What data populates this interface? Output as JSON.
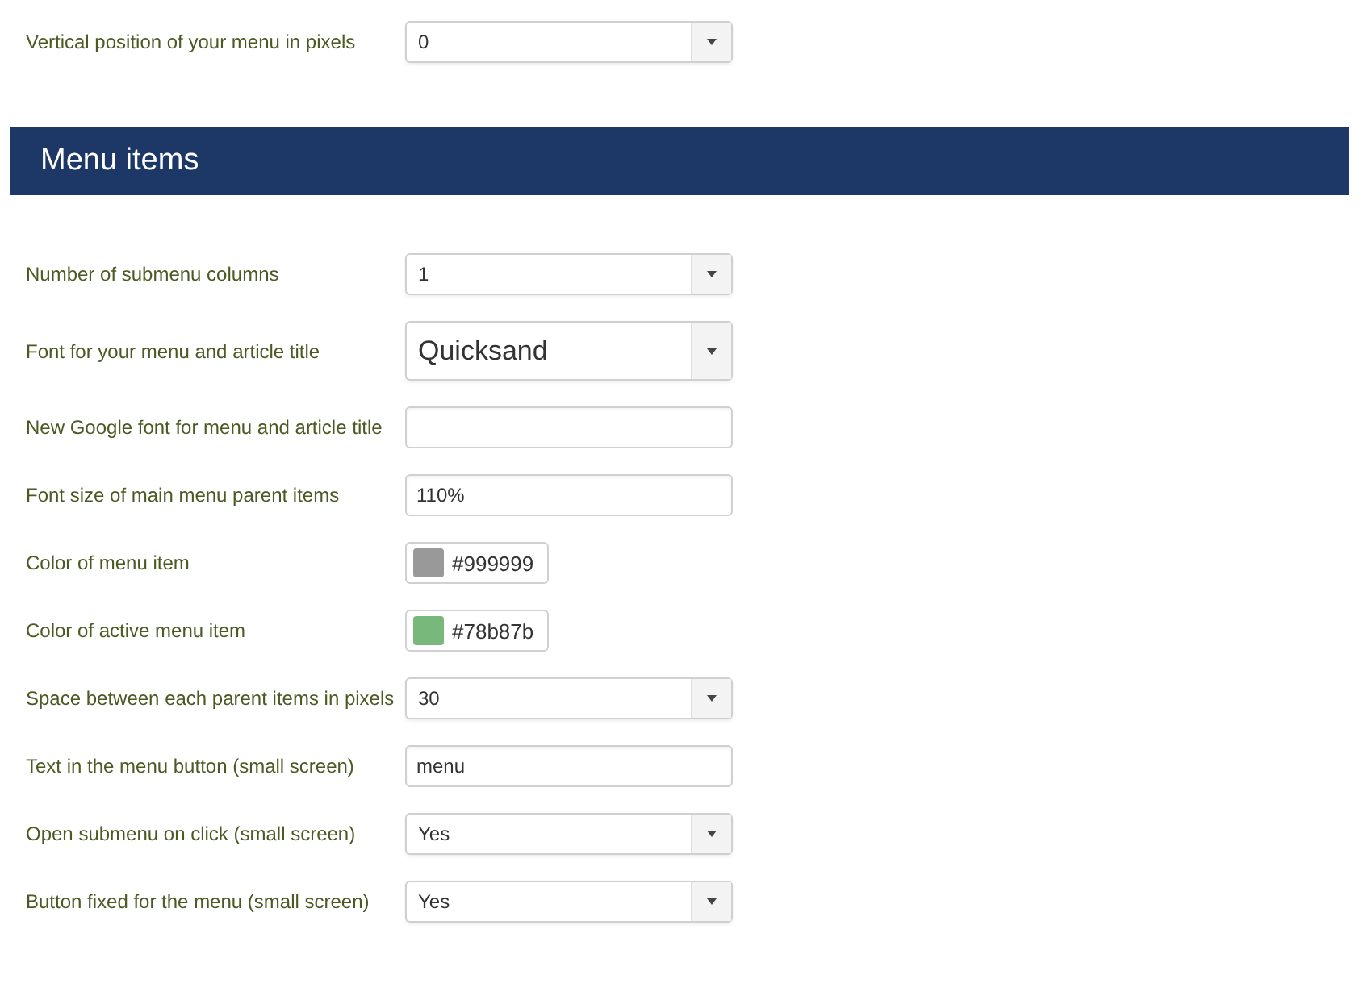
{
  "top_fields": [
    {
      "label": "Vertical position of your menu in pixels",
      "kind": "select",
      "value": "0"
    }
  ],
  "section": {
    "title": "Menu items"
  },
  "fields": [
    {
      "label": "Number of submenu columns",
      "kind": "select",
      "value": "1"
    },
    {
      "label": "Font for your menu and article title",
      "kind": "select_large",
      "value": "Quicksand"
    },
    {
      "label": "New Google font for menu and article title",
      "kind": "text"
    },
    {
      "label": "Font size of main menu parent items",
      "kind": "text",
      "value": "110%"
    },
    {
      "label": "Color of menu item",
      "kind": "color",
      "value": "#999999",
      "color": "#999999"
    },
    {
      "label": "Color of active menu item",
      "kind": "color",
      "value": "#78b87b",
      "color": "#78b87b"
    },
    {
      "label": "Space between each parent items in pixels",
      "kind": "select",
      "value": "30"
    },
    {
      "label": "Text in the menu button (small screen)",
      "kind": "text",
      "value": "menu"
    },
    {
      "label": "Open submenu on click (small screen)",
      "kind": "select",
      "value": "Yes"
    },
    {
      "label": "Button fixed for the menu (small screen)",
      "kind": "select",
      "value": "Yes"
    }
  ]
}
